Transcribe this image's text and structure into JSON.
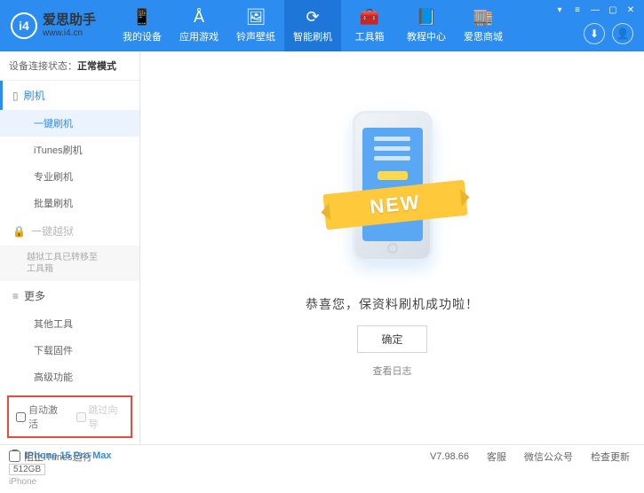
{
  "header": {
    "app_name": "爱思助手",
    "app_url": "www.i4.cn",
    "logo_text": "i4",
    "nav": [
      {
        "label": "我的设备",
        "icon": "📱"
      },
      {
        "label": "应用游戏",
        "icon": "Å"
      },
      {
        "label": "铃声壁纸",
        "icon": "🖼"
      },
      {
        "label": "智能刷机",
        "icon": "⟳"
      },
      {
        "label": "工具箱",
        "icon": "🧰"
      },
      {
        "label": "教程中心",
        "icon": "📘"
      },
      {
        "label": "爱思商城",
        "icon": "🏬"
      }
    ],
    "active_nav_index": 3
  },
  "sidebar": {
    "status_label": "设备连接状态：",
    "status_value": "正常模式",
    "section_flash": "刷机",
    "items_flash": [
      "一键刷机",
      "iTunes刷机",
      "专业刷机",
      "批量刷机"
    ],
    "active_flash_index": 0,
    "section_jailbreak": "一键越狱",
    "jailbreak_note": "越狱工具已转移至\n工具箱",
    "section_more": "更多",
    "items_more": [
      "其他工具",
      "下载固件",
      "高级功能"
    ],
    "checkbox_auto_activate": "自动激活",
    "checkbox_skip_guide": "跳过向导",
    "device": {
      "name": "iPhone 15 Pro Max",
      "storage": "512GB",
      "model": "iPhone"
    }
  },
  "main": {
    "ribbon": "NEW",
    "success": "恭喜您，保资料刷机成功啦！",
    "ok": "确定",
    "log_link": "查看日志"
  },
  "footer": {
    "block_itunes": "阻止iTunes运行",
    "version": "V7.98.66",
    "links": [
      "客服",
      "微信公众号",
      "检查更新"
    ]
  }
}
